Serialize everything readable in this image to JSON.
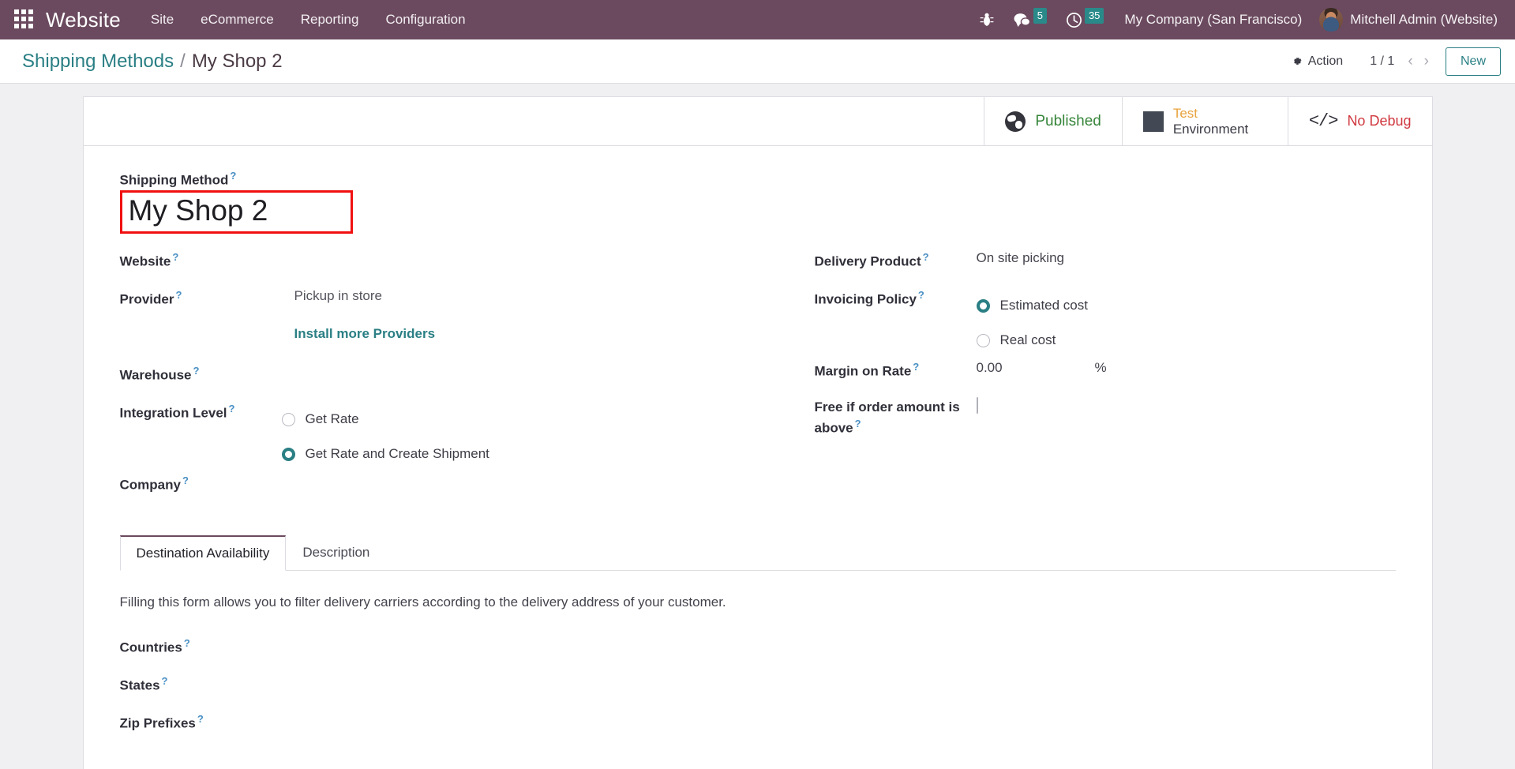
{
  "navbar": {
    "apps_icon": "apps-grid-icon",
    "brand": "Website",
    "menu": [
      {
        "label": "Site"
      },
      {
        "label": "eCommerce"
      },
      {
        "label": "Reporting"
      },
      {
        "label": "Configuration"
      }
    ],
    "bug_icon": "bug-icon",
    "messages": {
      "icon": "chat-bubble-icon",
      "count": "5"
    },
    "activities": {
      "icon": "clock-icon",
      "count": "35"
    },
    "company": "My Company (San Francisco)",
    "user": "Mitchell Admin (Website)",
    "bg_color": "#6b4a5f"
  },
  "control_panel": {
    "breadcrumb_root": "Shipping Methods",
    "breadcrumb_sep": "/",
    "breadcrumb_current": "My Shop 2",
    "action_label": "Action",
    "action_icon": "gear-icon",
    "pager": "1 / 1",
    "prev_icon": "chevron-left-icon",
    "next_icon": "chevron-right-icon",
    "new_label": "New",
    "accent_color": "#2a7f84"
  },
  "stat_buttons": [
    {
      "icon": "globe-icon",
      "label": "Published",
      "color": "#36853a"
    },
    {
      "icon": "square-icon",
      "label_top": "Test",
      "label_bottom": "Environment",
      "color": "#e8a33d"
    },
    {
      "icon": "code-icon",
      "icon_glyph": "</>",
      "label": "No Debug",
      "color": "#d0383f"
    }
  ],
  "form": {
    "title_label": "Shipping Method",
    "title_value": "My Shop 2",
    "title_highlight_color": "#f01010",
    "help_glyph": "?",
    "left_fields": [
      {
        "label": "Website",
        "value": ""
      },
      {
        "label": "Provider",
        "value": "Pickup in store"
      },
      {
        "label": "",
        "value": "Install more Providers",
        "is_link": true
      },
      {
        "label": "Warehouse",
        "value": ""
      }
    ],
    "integration_level": {
      "label": "Integration Level",
      "options": [
        {
          "label": "Get Rate",
          "selected": false
        },
        {
          "label": "Get Rate and Create Shipment",
          "selected": true
        }
      ]
    },
    "company_label": "Company",
    "company_value": "",
    "right_fields": [
      {
        "label": "Delivery Product",
        "value": "On site picking"
      }
    ],
    "invoicing_policy": {
      "label": "Invoicing Policy",
      "options": [
        {
          "label": "Estimated cost",
          "selected": true
        },
        {
          "label": "Real cost",
          "selected": false
        }
      ]
    },
    "margin_on_rate": {
      "label": "Margin on Rate",
      "value": "0.00",
      "unit": "%"
    },
    "free_if_above": {
      "label": "Free if order amount is above",
      "checked": false
    }
  },
  "notebook": {
    "tabs": [
      {
        "label": "Destination Availability",
        "active": true
      },
      {
        "label": "Description",
        "active": false
      }
    ],
    "active_pane": {
      "description": "Filling this form allows you to filter delivery carriers according to the delivery address of your customer.",
      "fields": [
        {
          "label": "Countries",
          "value": ""
        },
        {
          "label": "States",
          "value": ""
        },
        {
          "label": "Zip Prefixes",
          "value": ""
        }
      ]
    }
  }
}
